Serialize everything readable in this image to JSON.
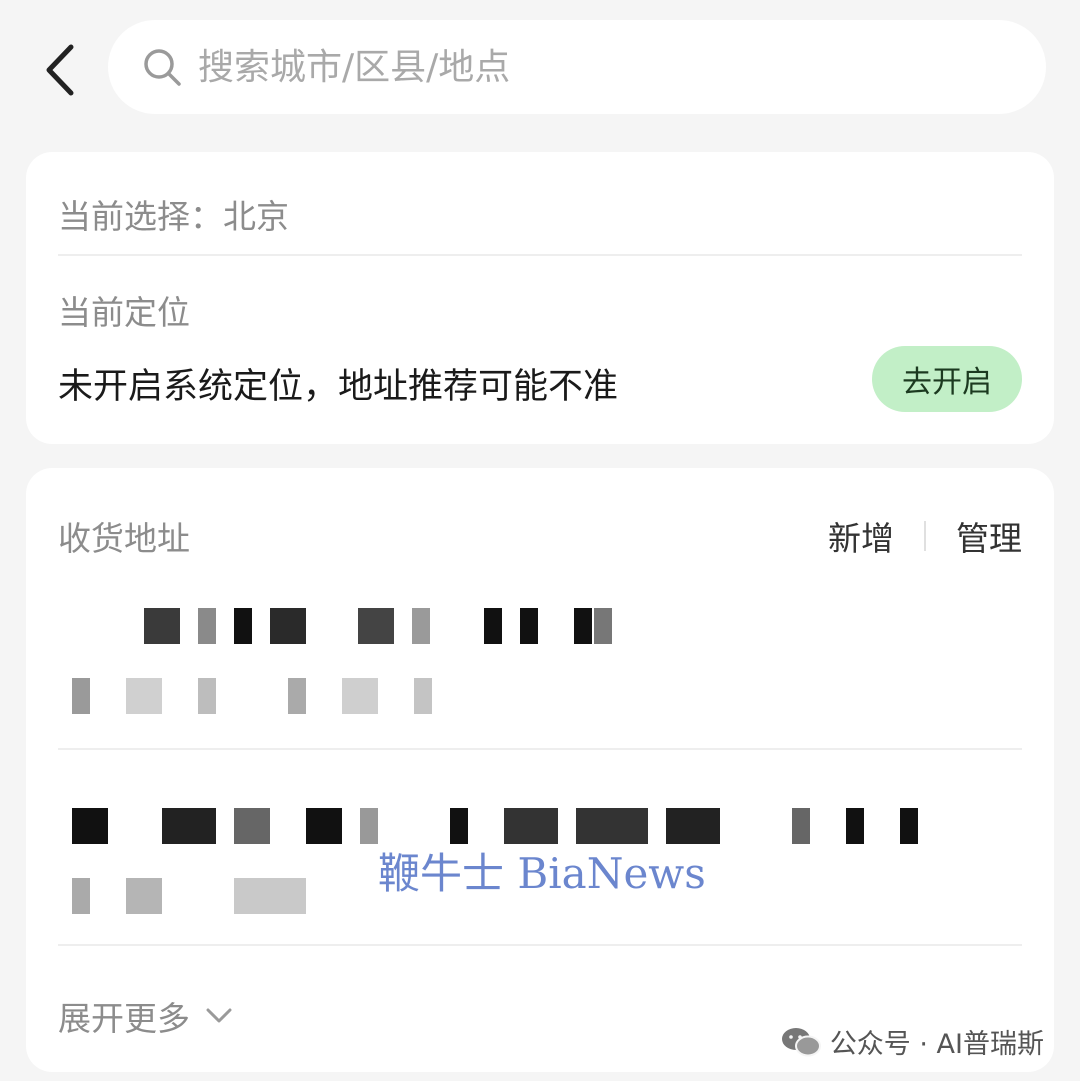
{
  "search": {
    "placeholder": "搜索城市/区县/地点"
  },
  "current": {
    "label": "当前选择：",
    "city": "北京",
    "location_title": "当前定位",
    "location_msg": "未开启系统定位，地址推荐可能不准",
    "open_button": "去开启"
  },
  "address": {
    "title": "收货地址",
    "add_label": "新增",
    "manage_label": "管理",
    "expand_label": "展开更多"
  },
  "watermarks": {
    "center": "鞭牛士 BiaNews",
    "corner": "公众号 · AI普瑞斯"
  },
  "colors": {
    "background": "#f5f5f5",
    "card": "#ffffff",
    "open_button_bg": "#c2efc7",
    "watermark_blue": "#5b7ac9"
  },
  "icons": [
    "back-arrow-icon",
    "search-icon",
    "chevron-down-icon",
    "wechat-icon"
  ]
}
